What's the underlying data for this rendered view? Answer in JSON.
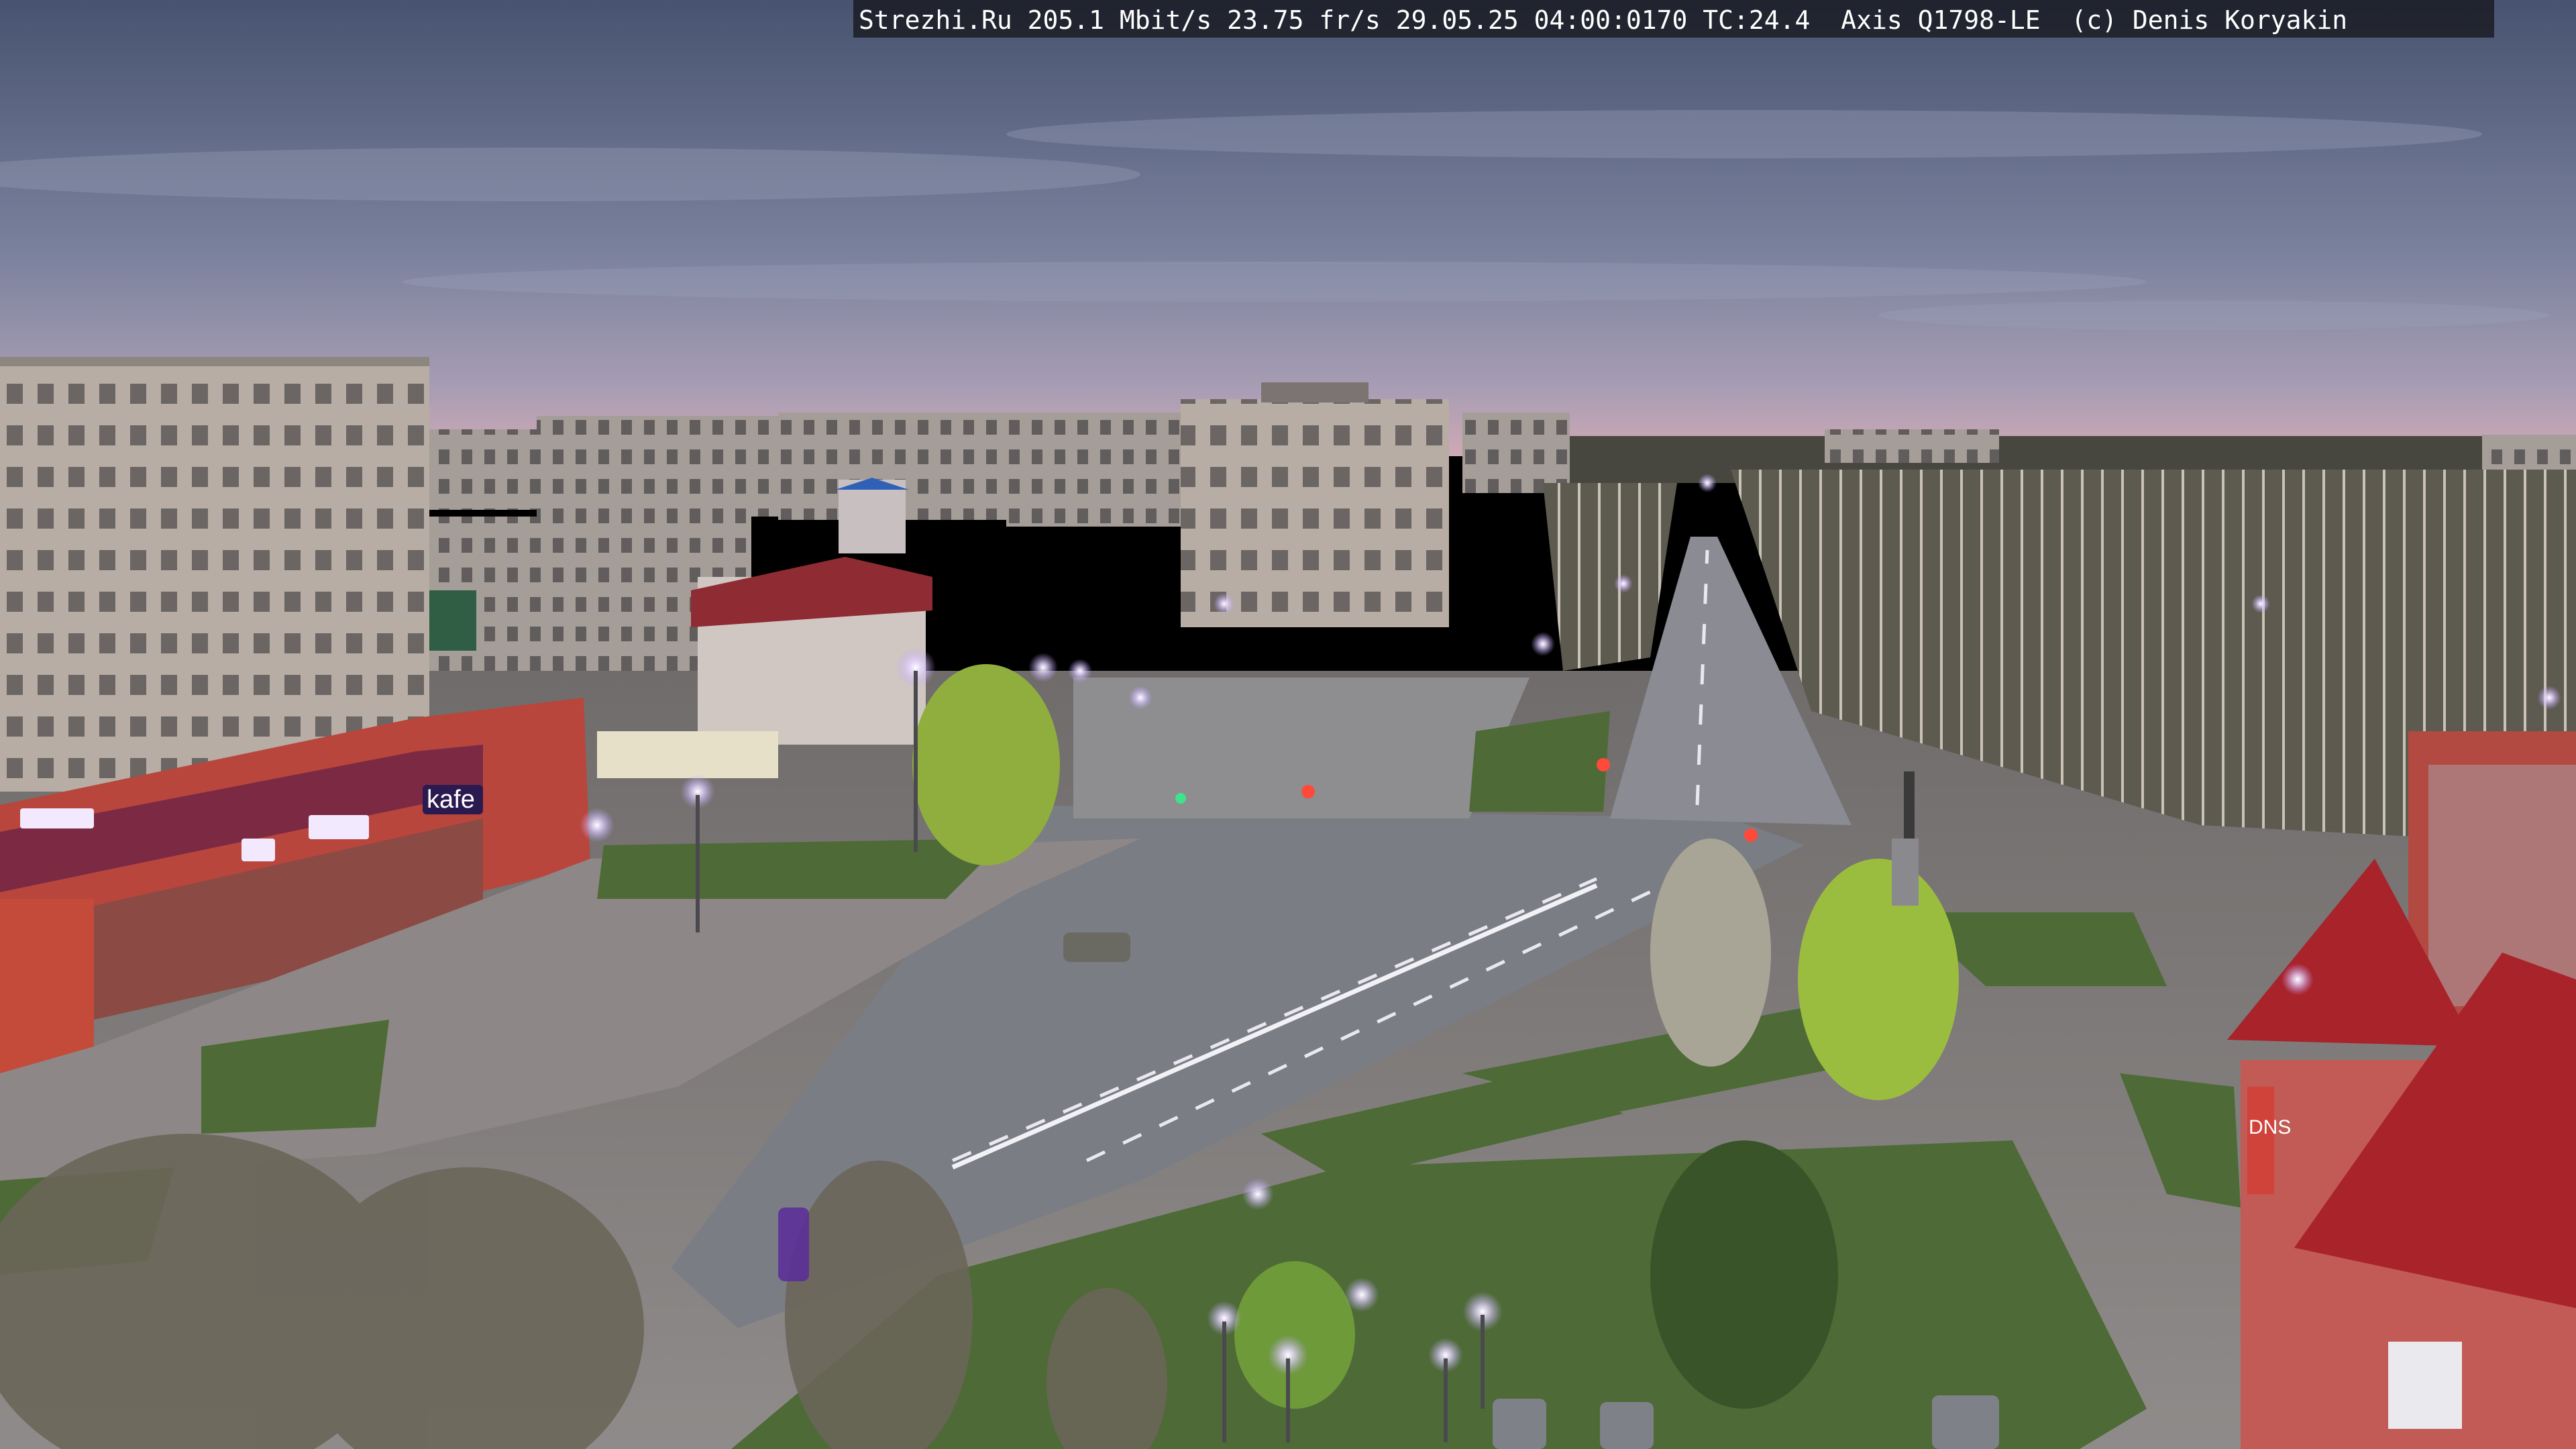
{
  "overlay": {
    "caption": "Strezhi.Ru 205.1 Mbit/s 23.75 fr/s 29.05.25 04:00:0170 TC:24.4  Axis Q1798-LE  (c) Denis Koryakin"
  },
  "scene": {
    "description_words": [
      "kafe",
      "DNS"
    ],
    "colors": {
      "sky_top": "#4a5570",
      "sky_mid": "#7c829d",
      "sky_horizon": "#c9a9b8",
      "road": "#7d7f86",
      "plaza": "#8a8889",
      "grass": "#4f6b38",
      "building_light": "#b9b0a7",
      "building_red": "#b3413a",
      "roof_red": "#a8232a",
      "trees": "#6b6759",
      "lamp": "#e9d7ff"
    }
  }
}
